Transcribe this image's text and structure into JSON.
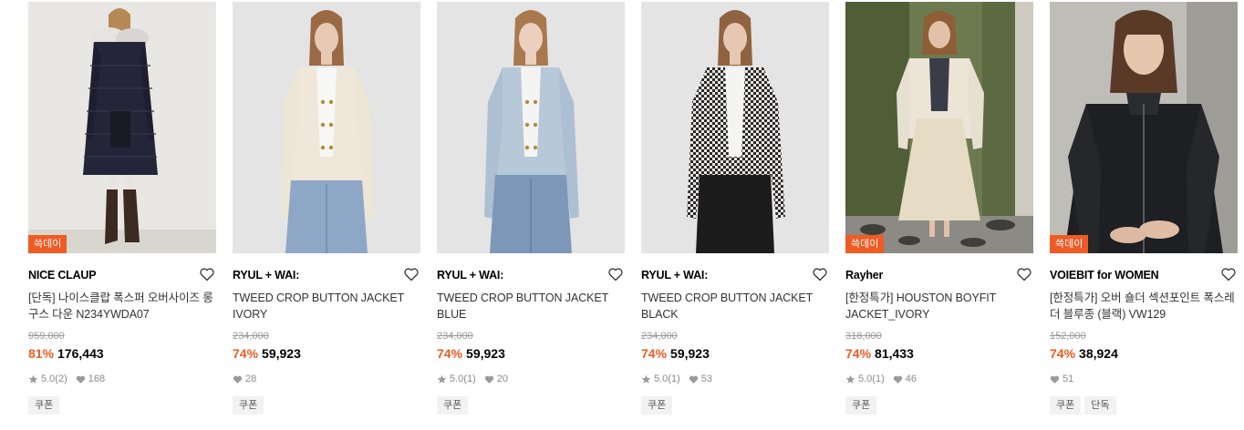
{
  "accent_color": "#f05a23",
  "products": [
    {
      "badge": "쓱데이",
      "brand": "NICE CLAUP",
      "title": "[단독] 나이스클랍 폭스퍼 오버사이즈 롱 구스 다운 N234YWDA07",
      "original_price": "959,000",
      "discount": "81%",
      "price": "176,443",
      "rating": "5.0",
      "review_count": "(2)",
      "likes": "168",
      "tags": [
        "쿠폰"
      ],
      "image": "long-navy-down-coat"
    },
    {
      "badge": "",
      "brand": "RYUL + WAI:",
      "title": "TWEED CROP BUTTON JACKET IVORY",
      "original_price": "234,000",
      "discount": "74%",
      "price": "59,923",
      "rating": "",
      "review_count": "",
      "likes": "28",
      "tags": [
        "쿠폰"
      ],
      "image": "ivory-tweed-jacket"
    },
    {
      "badge": "",
      "brand": "RYUL + WAI:",
      "title": "TWEED CROP BUTTON JACKET BLUE",
      "original_price": "234,000",
      "discount": "74%",
      "price": "59,923",
      "rating": "5.0",
      "review_count": "(1)",
      "likes": "20",
      "tags": [
        "쿠폰"
      ],
      "image": "blue-tweed-jacket"
    },
    {
      "badge": "",
      "brand": "RYUL + WAI:",
      "title": "TWEED CROP BUTTON JACKET BLACK",
      "original_price": "234,000",
      "discount": "74%",
      "price": "59,923",
      "rating": "5.0",
      "review_count": "(1)",
      "likes": "53",
      "tags": [
        "쿠폰"
      ],
      "image": "black-houndstooth-jacket"
    },
    {
      "badge": "쓱데이",
      "brand": "Rayher",
      "title": "[한정특가] HOUSTON BOYFIT JACKET_IVORY",
      "original_price": "318,000",
      "discount": "74%",
      "price": "81,433",
      "rating": "5.0",
      "review_count": "(1)",
      "likes": "46",
      "tags": [
        "쿠폰"
      ],
      "image": "ivory-boyfit-jacket"
    },
    {
      "badge": "쓱데이",
      "brand": "VOIEBIT for WOMEN",
      "title": "[한정특가] 오버 숄더 섹션포인트 폭스레더 블루종 (블랙) VW129",
      "original_price": "152,000",
      "discount": "74%",
      "price": "38,924",
      "rating": "",
      "review_count": "",
      "likes": "51",
      "tags": [
        "쿠폰",
        "단독"
      ],
      "image": "black-leather-blouson"
    }
  ]
}
